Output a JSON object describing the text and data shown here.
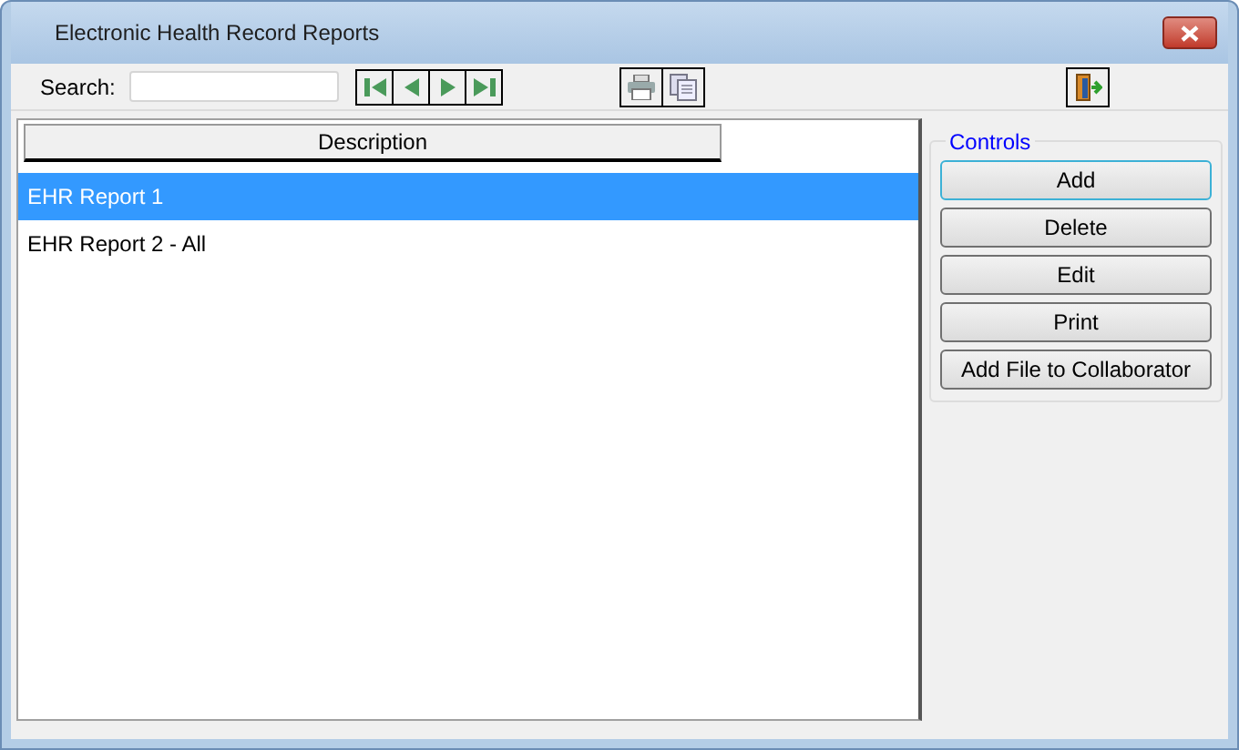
{
  "window": {
    "title": "Electronic Health Record Reports"
  },
  "toolbar": {
    "search_label": "Search:"
  },
  "list": {
    "columns": [
      "Description"
    ],
    "rows": [
      {
        "description": "EHR Report 1",
        "selected": true
      },
      {
        "description": "EHR Report 2 - All",
        "selected": false
      }
    ]
  },
  "controls": {
    "title": "Controls",
    "buttons": [
      {
        "label": "Add",
        "focused": true
      },
      {
        "label": "Delete",
        "focused": false
      },
      {
        "label": "Edit",
        "focused": false
      },
      {
        "label": "Print",
        "focused": false
      },
      {
        "label": "Add File to Collaborator",
        "focused": false
      }
    ]
  }
}
